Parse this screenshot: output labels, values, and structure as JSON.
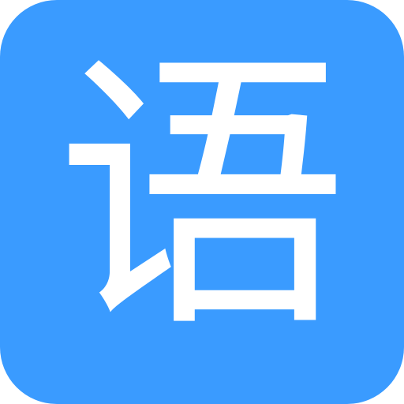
{
  "icon": {
    "glyph": "语",
    "background_color": "#3a9bff",
    "glyph_color": "#ffffff"
  }
}
